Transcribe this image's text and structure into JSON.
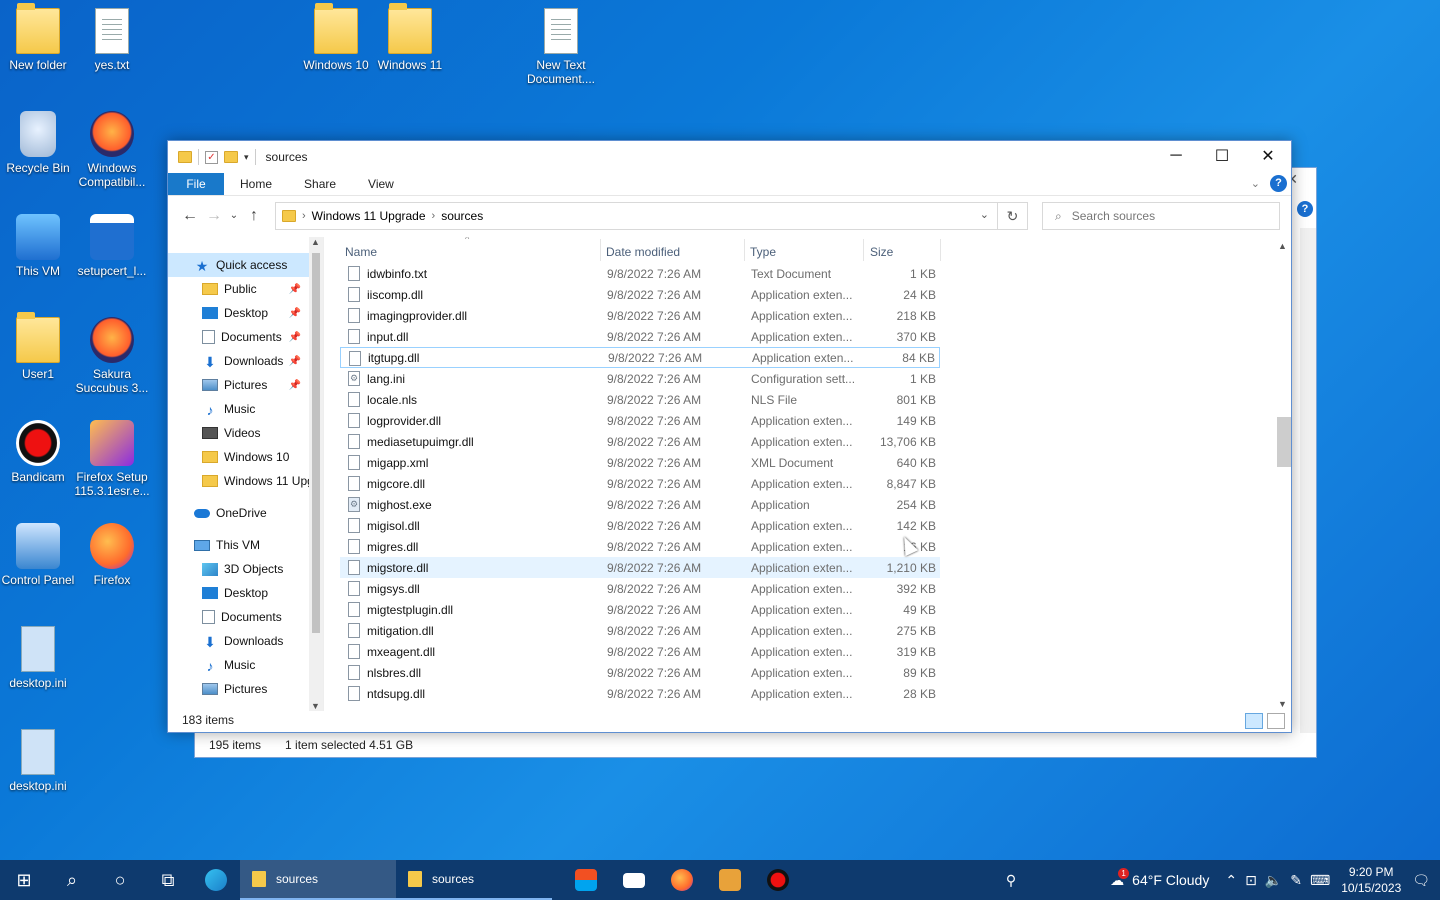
{
  "desktop": {
    "icons": [
      {
        "label": "New folder",
        "kind": "folder"
      },
      {
        "label": "yes.txt",
        "kind": "doc"
      },
      {
        "label": "Windows 10",
        "kind": "folder"
      },
      {
        "label": "Windows 11",
        "kind": "folder"
      },
      {
        "label": "New Text Document....",
        "kind": "doc"
      },
      {
        "label": "Recycle Bin",
        "kind": "bin"
      },
      {
        "label": "Windows Compatibil...",
        "kind": "app"
      },
      {
        "label": "This VM",
        "kind": "pc"
      },
      {
        "label": "setupcert_l...",
        "kind": "app"
      },
      {
        "label": "User1",
        "kind": "folder"
      },
      {
        "label": "Sakura Succubus 3...",
        "kind": "app"
      },
      {
        "label": "Bandicam",
        "kind": "app"
      },
      {
        "label": "Firefox Setup 115.3.1esr.e...",
        "kind": "app"
      },
      {
        "label": "Control Panel",
        "kind": "app"
      },
      {
        "label": "Firefox",
        "kind": "app"
      },
      {
        "label": "desktop.ini",
        "kind": "ini"
      },
      {
        "label": "desktop.ini",
        "kind": "ini"
      }
    ]
  },
  "back_window": {
    "status_count": "195 items",
    "status_selected": "1 item selected  4.51 GB"
  },
  "window": {
    "title": "sources",
    "ribbon_tabs": {
      "file": "File",
      "home": "Home",
      "share": "Share",
      "view": "View"
    },
    "help": "?",
    "address": {
      "crumb1": "Windows 11 Upgrade",
      "crumb2": "sources"
    },
    "search_placeholder": "Search sources",
    "nav_pane": [
      {
        "label": "Quick access",
        "icon": "star",
        "indent": 1,
        "selected": true,
        "pinned": false
      },
      {
        "label": "Public",
        "icon": "folder",
        "indent": 2,
        "pinned": true
      },
      {
        "label": "Desktop",
        "icon": "desktop",
        "indent": 2,
        "pinned": true
      },
      {
        "label": "Documents",
        "icon": "doc",
        "indent": 2,
        "pinned": true
      },
      {
        "label": "Downloads",
        "icon": "down",
        "indent": 2,
        "pinned": true
      },
      {
        "label": "Pictures",
        "icon": "pic",
        "indent": 2,
        "pinned": true
      },
      {
        "label": "Music",
        "icon": "music",
        "indent": 2,
        "pinned": false
      },
      {
        "label": "Videos",
        "icon": "video",
        "indent": 2,
        "pinned": false
      },
      {
        "label": "Windows 10",
        "icon": "folder",
        "indent": 2,
        "pinned": false
      },
      {
        "label": "Windows 11 Upg",
        "icon": "folder",
        "indent": 2,
        "pinned": false
      },
      {
        "label": "OneDrive",
        "icon": "cloud",
        "indent": 1,
        "gap": true,
        "pinned": false
      },
      {
        "label": "This VM",
        "icon": "pc",
        "indent": 1,
        "gap": true,
        "pinned": false
      },
      {
        "label": "3D Objects",
        "icon": "3d",
        "indent": 2,
        "pinned": false
      },
      {
        "label": "Desktop",
        "icon": "desktop",
        "indent": 2,
        "pinned": false
      },
      {
        "label": "Documents",
        "icon": "doc",
        "indent": 2,
        "pinned": false
      },
      {
        "label": "Downloads",
        "icon": "down",
        "indent": 2,
        "pinned": false
      },
      {
        "label": "Music",
        "icon": "music",
        "indent": 2,
        "pinned": false
      },
      {
        "label": "Pictures",
        "icon": "pic",
        "indent": 2,
        "pinned": false
      }
    ],
    "columns": {
      "name": "Name",
      "date": "Date modified",
      "type": "Type",
      "size": "Size"
    },
    "files": [
      {
        "name": "idwbinfo.txt",
        "date": "9/8/2022 7:26 AM",
        "type": "Text Document",
        "size": "1 KB"
      },
      {
        "name": "iiscomp.dll",
        "date": "9/8/2022 7:26 AM",
        "type": "Application exten...",
        "size": "24 KB"
      },
      {
        "name": "imagingprovider.dll",
        "date": "9/8/2022 7:26 AM",
        "type": "Application exten...",
        "size": "218 KB"
      },
      {
        "name": "input.dll",
        "date": "9/8/2022 7:26 AM",
        "type": "Application exten...",
        "size": "370 KB"
      },
      {
        "name": "itgtupg.dll",
        "date": "9/8/2022 7:26 AM",
        "type": "Application exten...",
        "size": "84 KB",
        "focus": true
      },
      {
        "name": "lang.ini",
        "date": "9/8/2022 7:26 AM",
        "type": "Configuration sett...",
        "size": "1 KB",
        "gear": true
      },
      {
        "name": "locale.nls",
        "date": "9/8/2022 7:26 AM",
        "type": "NLS File",
        "size": "801 KB"
      },
      {
        "name": "logprovider.dll",
        "date": "9/8/2022 7:26 AM",
        "type": "Application exten...",
        "size": "149 KB"
      },
      {
        "name": "mediasetupuimgr.dll",
        "date": "9/8/2022 7:26 AM",
        "type": "Application exten...",
        "size": "13,706 KB"
      },
      {
        "name": "migapp.xml",
        "date": "9/8/2022 7:26 AM",
        "type": "XML Document",
        "size": "640 KB"
      },
      {
        "name": "migcore.dll",
        "date": "9/8/2022 7:26 AM",
        "type": "Application exten...",
        "size": "8,847 KB"
      },
      {
        "name": "mighost.exe",
        "date": "9/8/2022 7:26 AM",
        "type": "Application",
        "size": "254 KB",
        "exe": true
      },
      {
        "name": "migisol.dll",
        "date": "9/8/2022 7:26 AM",
        "type": "Application exten...",
        "size": "142 KB"
      },
      {
        "name": "migres.dll",
        "date": "9/8/2022 7:26 AM",
        "type": "Application exten...",
        "size": "16 KB"
      },
      {
        "name": "migstore.dll",
        "date": "9/8/2022 7:26 AM",
        "type": "Application exten...",
        "size": "1,210 KB",
        "hover": true
      },
      {
        "name": "migsys.dll",
        "date": "9/8/2022 7:26 AM",
        "type": "Application exten...",
        "size": "392 KB"
      },
      {
        "name": "migtestplugin.dll",
        "date": "9/8/2022 7:26 AM",
        "type": "Application exten...",
        "size": "49 KB"
      },
      {
        "name": "mitigation.dll",
        "date": "9/8/2022 7:26 AM",
        "type": "Application exten...",
        "size": "275 KB"
      },
      {
        "name": "mxeagent.dll",
        "date": "9/8/2022 7:26 AM",
        "type": "Application exten...",
        "size": "319 KB"
      },
      {
        "name": "nlsbres.dll",
        "date": "9/8/2022 7:26 AM",
        "type": "Application exten...",
        "size": "89 KB"
      },
      {
        "name": "ntdsupg.dll",
        "date": "9/8/2022 7:26 AM",
        "type": "Application exten...",
        "size": "28 KB"
      }
    ],
    "status_count": "183 items"
  },
  "taskbar": {
    "tasks": [
      {
        "label": "sources",
        "active": true
      },
      {
        "label": "sources",
        "active": false
      }
    ],
    "weather": "64°F  Cloudy",
    "weather_badge": "1",
    "time": "9:20 PM",
    "date": "10/15/2023"
  },
  "colors": {
    "accent": "#1979ca",
    "taskbar": "#0e3a6e",
    "selection": "#cce8ff"
  }
}
